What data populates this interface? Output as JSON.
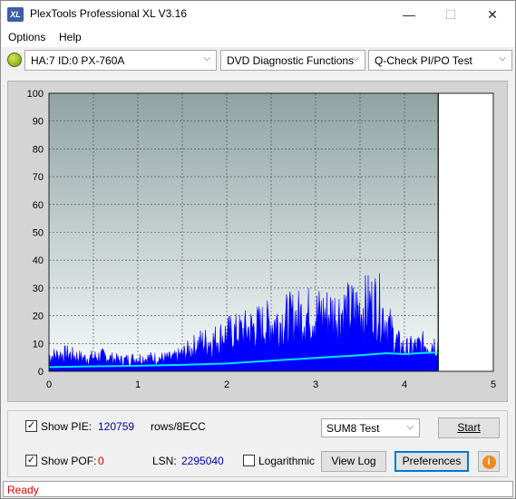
{
  "window": {
    "title": "PlexTools Professional XL V3.16",
    "icon_label": "XL",
    "minimize_icon": "minimize-icon",
    "maximize_icon": "maximize-icon",
    "close_icon": "close-icon"
  },
  "menu": {
    "items": [
      {
        "label": "Options"
      },
      {
        "label": "Help"
      }
    ]
  },
  "toolbar": {
    "drive": "HA:7 ID:0  PX-760A",
    "function": "DVD Diagnostic Functions",
    "test": "Q-Check PI/PO Test"
  },
  "chart_data": {
    "type": "area",
    "x_ticks": [
      "0",
      "1",
      "2",
      "3",
      "4",
      "5"
    ],
    "y_ticks": [
      "0",
      "10",
      "20",
      "30",
      "40",
      "50",
      "60",
      "70",
      "80",
      "90",
      "100"
    ],
    "xlim": [
      0,
      5
    ],
    "ylim": [
      0,
      100
    ],
    "marker_x": 4.38,
    "grid": true,
    "series": [
      {
        "color": "#0000ff",
        "x": [
          0,
          0.2,
          0.4,
          0.6,
          0.8,
          1.0,
          1.2,
          1.4,
          1.55,
          1.7,
          1.85,
          2.0,
          2.15,
          2.3,
          2.5,
          2.7,
          2.9,
          3.1,
          3.3,
          3.5,
          3.6,
          3.7,
          3.8,
          3.9,
          4.0,
          4.1,
          4.2,
          4.3,
          4.38
        ],
        "y": [
          7,
          8,
          6,
          7,
          5,
          6,
          6,
          6,
          9,
          13,
          14,
          17,
          18,
          20,
          22,
          24,
          26,
          26,
          27,
          28,
          30,
          31,
          23,
          14,
          10,
          11,
          12,
          13,
          12
        ]
      },
      {
        "color": "#00e5ff",
        "x": [
          0,
          0.5,
          1.0,
          1.5,
          2.0,
          2.5,
          3.0,
          3.5,
          3.8,
          4.0,
          4.2,
          4.38
        ],
        "y": [
          1.5,
          1.8,
          2.0,
          2.3,
          2.8,
          3.8,
          4.8,
          5.8,
          6.5,
          6.2,
          6.6,
          6.8
        ]
      }
    ],
    "background_top": "#8fa3a3",
    "background_bottom": "#f7fafa"
  },
  "controls": {
    "show_pie_label": "Show PIE:",
    "pie_value": "120759",
    "pie_unit": "rows/8ECC",
    "show_pof_label": "Show POF:",
    "pof_value": "0",
    "lsn_label": "LSN:",
    "lsn_value": "2295040",
    "logarithmic_label": "Logarithmic",
    "test_select": "SUM8 Test",
    "start_label": "Start",
    "view_log_label": "View Log",
    "preferences_label": "Preferences",
    "info_icon": "info-icon",
    "pie_checked": true,
    "pof_checked": true,
    "log_checked": false
  },
  "status": {
    "text": "Ready"
  },
  "colors": {
    "pie_value": "#0000a0",
    "pof_value": "#d00000",
    "lsn_value": "#0000a0",
    "status": "#e00000"
  }
}
